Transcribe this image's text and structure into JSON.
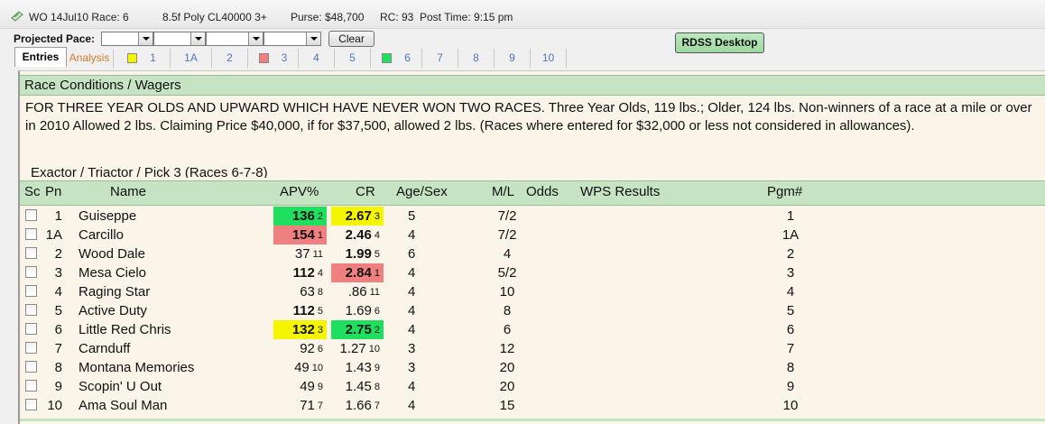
{
  "title_bar": {
    "track_date_race": "WO 14Jul10 Race: 6",
    "distance_surface": "8.5f  Poly  CL40000  3+",
    "purse": "Purse: $48,700",
    "rc": "RC: 93",
    "post_time": "Post Time: 9:15 pm"
  },
  "pace": {
    "label": "Projected Pace:",
    "clear_label": "Clear"
  },
  "rdss_label": "RDSS Desktop",
  "tabs": [
    "Entries",
    "Analysis",
    "1",
    "1A",
    "2",
    "3",
    "4",
    "5",
    "6",
    "7",
    "8",
    "9",
    "10"
  ],
  "tab_swatches": {
    "1": "#f5f500",
    "3": "#f07f7f",
    "6": "#1fdf5f"
  },
  "conditions": {
    "header": "Race Conditions / Wagers",
    "text": "FOR THREE YEAR OLDS AND UPWARD WHICH HAVE NEVER WON TWO RACES. Three Year Olds, 119 lbs.; Older, 124 lbs. Non-winners of a race at a mile or over in 2010 Allowed 2 lbs. Claiming Price $40,000, if for $37,500, allowed 2 lbs. (Races where entered for $32,000 or less not considered in allowances).",
    "wagers": "Exactor / Triactor / Pick 3 (Races 6-7-8)"
  },
  "columns": {
    "sc": "Sc",
    "pn": "Pn",
    "name": "Name",
    "apv": "APV%",
    "cr": "CR",
    "age_sex": "Age/Sex",
    "ml": "M/L",
    "odds": "Odds",
    "wps": "WPS Results",
    "pgm": "Pgm#"
  },
  "entries": [
    {
      "pn": "1",
      "name": "Guiseppe",
      "apv": "136",
      "apv_rank": "2",
      "apv_bold": true,
      "apv_hl": "green",
      "cr": "2.67",
      "cr_rank": "3",
      "cr_bold": true,
      "cr_hl": "yellow",
      "age": "5",
      "ml": "7/2",
      "pgm": "1"
    },
    {
      "pn": "1A",
      "name": "Carcillo",
      "apv": "154",
      "apv_rank": "1",
      "apv_bold": true,
      "apv_hl": "red",
      "cr": "2.46",
      "cr_rank": "4",
      "cr_bold": true,
      "cr_hl": "",
      "age": "4",
      "ml": "7/2",
      "pgm": "1A"
    },
    {
      "pn": "2",
      "name": "Wood Dale",
      "apv": "37",
      "apv_rank": "11",
      "apv_bold": false,
      "apv_hl": "",
      "cr": "1.99",
      "cr_rank": "5",
      "cr_bold": true,
      "cr_hl": "",
      "age": "6",
      "ml": "4",
      "pgm": "2"
    },
    {
      "pn": "3",
      "name": "Mesa Cielo",
      "apv": "112",
      "apv_rank": "4",
      "apv_bold": true,
      "apv_hl": "",
      "cr": "2.84",
      "cr_rank": "1",
      "cr_bold": true,
      "cr_hl": "red",
      "age": "4",
      "ml": "5/2",
      "pgm": "3"
    },
    {
      "pn": "4",
      "name": "Raging Star",
      "apv": "63",
      "apv_rank": "8",
      "apv_bold": false,
      "apv_hl": "",
      "cr": ".86",
      "cr_rank": "11",
      "cr_bold": false,
      "cr_hl": "",
      "age": "4",
      "ml": "10",
      "pgm": "4"
    },
    {
      "pn": "5",
      "name": "Active Duty",
      "apv": "112",
      "apv_rank": "5",
      "apv_bold": true,
      "apv_hl": "",
      "cr": "1.69",
      "cr_rank": "6",
      "cr_bold": false,
      "cr_hl": "",
      "age": "4",
      "ml": "8",
      "pgm": "5"
    },
    {
      "pn": "6",
      "name": "Little Red Chris",
      "apv": "132",
      "apv_rank": "3",
      "apv_bold": true,
      "apv_hl": "yellow",
      "cr": "2.75",
      "cr_rank": "2",
      "cr_bold": true,
      "cr_hl": "green",
      "age": "4",
      "ml": "6",
      "pgm": "6"
    },
    {
      "pn": "7",
      "name": "Carnduff",
      "apv": "92",
      "apv_rank": "6",
      "apv_bold": false,
      "apv_hl": "",
      "cr": "1.27",
      "cr_rank": "10",
      "cr_bold": false,
      "cr_hl": "",
      "age": "3",
      "ml": "12",
      "pgm": "7"
    },
    {
      "pn": "8",
      "name": "Montana Memories",
      "apv": "49",
      "apv_rank": "10",
      "apv_bold": false,
      "apv_hl": "",
      "cr": "1.43",
      "cr_rank": "9",
      "cr_bold": false,
      "cr_hl": "",
      "age": "3",
      "ml": "20",
      "pgm": "8"
    },
    {
      "pn": "9",
      "name": "Scopin' U Out",
      "apv": "49",
      "apv_rank": "9",
      "apv_bold": false,
      "apv_hl": "",
      "cr": "1.45",
      "cr_rank": "8",
      "cr_bold": false,
      "cr_hl": "",
      "age": "4",
      "ml": "20",
      "pgm": "9"
    },
    {
      "pn": "10",
      "name": "Ama Soul Man",
      "apv": "71",
      "apv_rank": "7",
      "apv_bold": false,
      "apv_hl": "",
      "cr": "1.66",
      "cr_rank": "7",
      "cr_bold": false,
      "cr_hl": "",
      "age": "4",
      "ml": "15",
      "pgm": "10"
    }
  ]
}
